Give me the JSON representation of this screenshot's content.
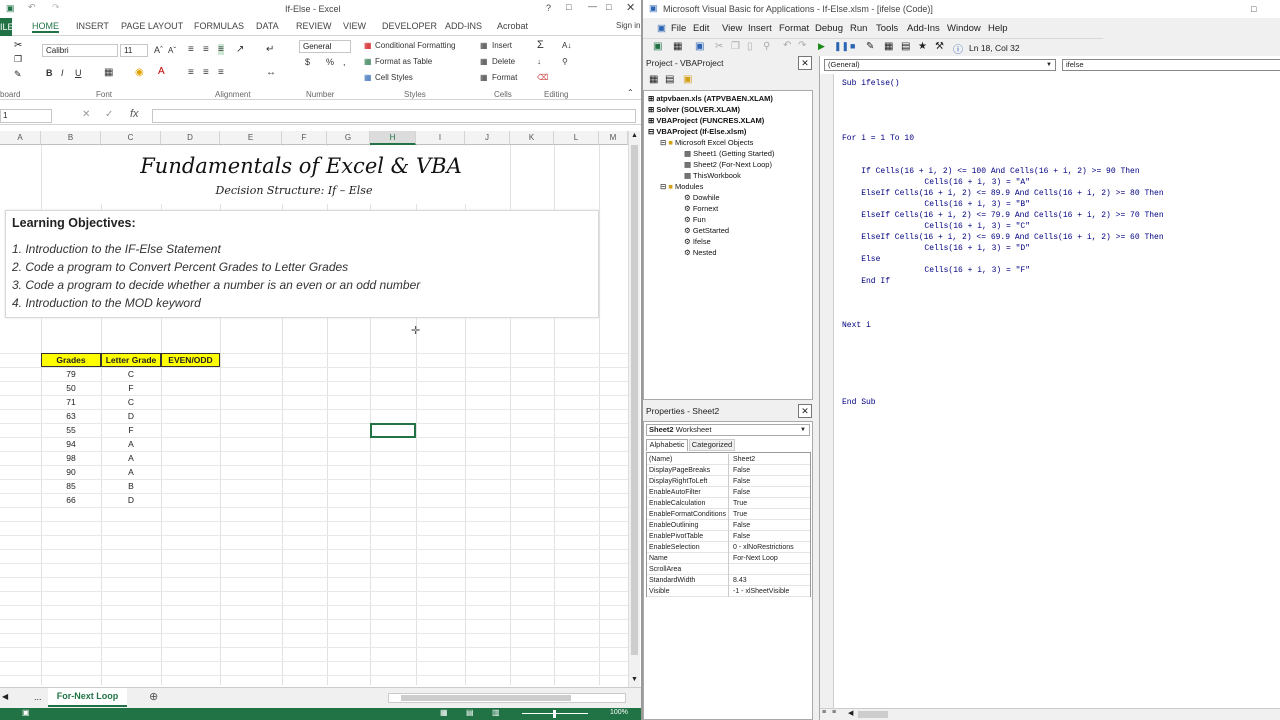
{
  "excel": {
    "window_title": "If-Else - Excel",
    "sign_in": "Sign in",
    "ribbon_tabs": [
      "ILE",
      "HOME",
      "INSERT",
      "PAGE LAYOUT",
      "FORMULAS",
      "DATA",
      "REVIEW",
      "VIEW",
      "DEVELOPER",
      "ADD-INS",
      "Acrobat"
    ],
    "font_name": "Calibri",
    "font_size": "11",
    "number_format": "General",
    "styles": {
      "conditional": "Conditional Formatting",
      "format_table": "Format as Table",
      "cell_styles": "Cell Styles"
    },
    "cells_group": {
      "insert": "Insert",
      "delete": "Delete",
      "format": "Format"
    },
    "group_labels": {
      "clipboard": "board",
      "font": "Font",
      "alignment": "Alignment",
      "number": "Number",
      "styles": "Styles",
      "cells": "Cells",
      "editing": "Editing"
    },
    "name_box": "1",
    "formula_fx": "fx",
    "columns": [
      "A",
      "B",
      "C",
      "D",
      "E",
      "F",
      "G",
      "H",
      "I",
      "J",
      "K",
      "L",
      "M"
    ],
    "heading": "Fundamentals of Excel & VBA",
    "subheading": "Decision Structure: If – Else",
    "objectives_title": "Learning Objectives:",
    "objectives": [
      "1. Introduction to the IF-Else Statement",
      "2. Code a program to Convert Percent Grades to Letter Grades",
      "3. Code a program to decide whether a number is an even or an odd number",
      "4. Introduction to the MOD keyword"
    ],
    "table_headers": [
      "Grades",
      "Letter Grade",
      "EVEN/ODD"
    ],
    "table_rows": [
      [
        "79",
        "C"
      ],
      [
        "50",
        "F"
      ],
      [
        "71",
        "C"
      ],
      [
        "63",
        "D"
      ],
      [
        "55",
        "F"
      ],
      [
        "94",
        "A"
      ],
      [
        "98",
        "A"
      ],
      [
        "90",
        "A"
      ],
      [
        "85",
        "B"
      ],
      [
        "66",
        "D"
      ]
    ],
    "sheet_tab": "For-Next Loop",
    "sheet_nav": "...",
    "zoom": "100%",
    "accent": "#217346",
    "header_fill": "#ffff00"
  },
  "vba": {
    "window_title": "Microsoft Visual Basic for Applications - If-Else.xlsm - [ifelse (Code)]",
    "menu": [
      "File",
      "Edit",
      "Insert",
      "Format",
      "Debug",
      "Run",
      "Tools",
      "Add-Ins",
      "Window",
      "Help"
    ],
    "position": "Ln 18, Col 32",
    "project_title": "Project - VBAProject",
    "tree": [
      "atpvbaen.xls (ATPVBAEN.XLAM)",
      "Solver (SOLVER.XLAM)",
      "VBAProject (FUNCRES.XLAM)",
      "VBAProject (If-Else.xlsm)",
      "Microsoft Excel Objects",
      "Sheet1 (Getting Started)",
      "Sheet2 (For-Next Loop)",
      "ThisWorkbook",
      "Modules",
      "Dowhile",
      "Fornext",
      "Fun",
      "GetStarted",
      "Ifelse",
      "Nested"
    ],
    "properties_title": "Properties - Sheet2",
    "properties_object": "Sheet2",
    "properties_type": "Worksheet",
    "properties_tabs": [
      "Alphabetic",
      "Categorized"
    ],
    "properties": [
      [
        "(Name)",
        "Sheet2"
      ],
      [
        "DisplayPageBreaks",
        "False"
      ],
      [
        "DisplayRightToLeft",
        "False"
      ],
      [
        "EnableAutoFilter",
        "False"
      ],
      [
        "EnableCalculation",
        "True"
      ],
      [
        "EnableFormatConditions",
        "True"
      ],
      [
        "EnableOutlining",
        "False"
      ],
      [
        "EnablePivotTable",
        "False"
      ],
      [
        "EnableSelection",
        "0 - xlNoRestrictions"
      ],
      [
        "Name",
        "For-Next Loop"
      ],
      [
        "ScrollArea",
        ""
      ],
      [
        "StandardWidth",
        "8.43"
      ],
      [
        "Visible",
        "-1 - xlSheetVisible"
      ]
    ],
    "object_dropdown": "(General)",
    "procedure_dropdown": "ifelse",
    "code": [
      "Sub ifelse()",
      "For i = 1 To 10",
      "    If Cells(16 + i, 2) <= 100 And Cells(16 + i, 2) >= 90 Then",
      "        Cells(16 + i, 3) = \"A\"",
      "    ElseIf Cells(16 + i, 2) <= 89.9 And Cells(16 + i, 2) >= 80 Then",
      "        Cells(16 + i, 3) = \"B\"",
      "    ElseIf Cells(16 + i, 2) <= 79.9 And Cells(16 + i, 2) >= 70 Then",
      "        Cells(16 + i, 3) = \"C\"",
      "    ElseIf Cells(16 + i, 2) <= 69.9 And Cells(16 + i, 2) >= 60 Then",
      "        Cells(16 + i, 3) = \"D\"",
      "    Else",
      "        Cells(16 + i, 3) = \"F\"",
      "    End If",
      "Next i",
      "End Sub"
    ]
  }
}
